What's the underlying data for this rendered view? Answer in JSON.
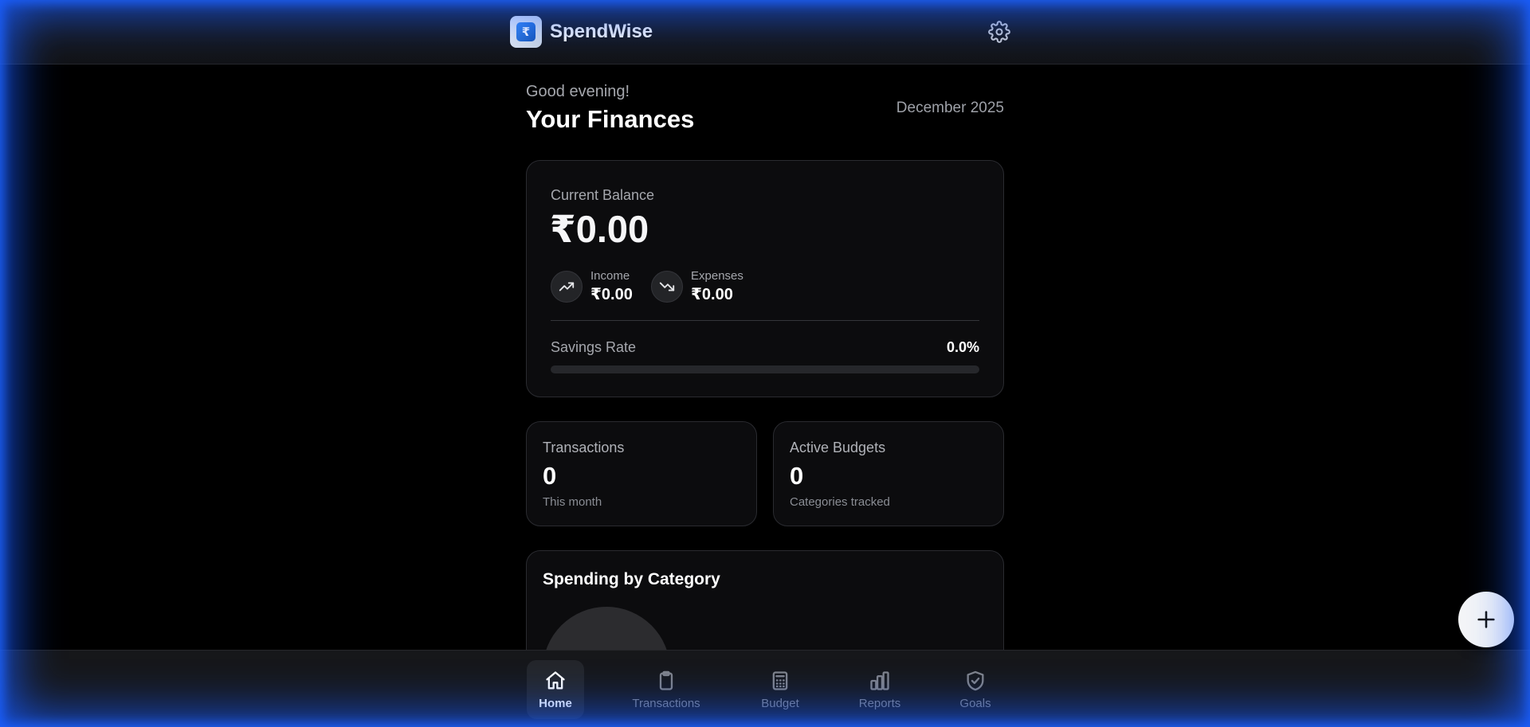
{
  "header": {
    "app_name": "SpendWise",
    "logo_glyph": "₹",
    "logo_icon": "rupee-logo-icon",
    "settings_icon": "gear-icon"
  },
  "greeting": {
    "salutation": "Good evening!",
    "title": "Your Finances",
    "month": "December 2025"
  },
  "balance": {
    "label": "Current Balance",
    "value": "₹0.00",
    "income_label": "Income",
    "income_value": "₹0.00",
    "expenses_label": "Expenses",
    "expenses_value": "₹0.00",
    "savings_label": "Savings Rate",
    "savings_value": "0.0%",
    "savings_fraction": 0
  },
  "stats": [
    {
      "label": "Transactions",
      "value": "0",
      "sub": "This month"
    },
    {
      "label": "Active Budgets",
      "value": "0",
      "sub": "Categories tracked"
    }
  ],
  "spending": {
    "title": "Spending by Category"
  },
  "fab": {
    "icon": "plus-icon"
  },
  "nav": {
    "items": [
      {
        "label": "Home",
        "icon": "home-icon",
        "active": true
      },
      {
        "label": "Transactions",
        "icon": "clipboard-icon",
        "active": false
      },
      {
        "label": "Budget",
        "icon": "calculator-icon",
        "active": false
      },
      {
        "label": "Reports",
        "icon": "bar-chart-icon",
        "active": false
      },
      {
        "label": "Goals",
        "icon": "shield-check-icon",
        "active": false
      }
    ]
  },
  "colors": {
    "accent_glow": "#165aff",
    "background": "#000000",
    "card": "#0c0c0e"
  }
}
